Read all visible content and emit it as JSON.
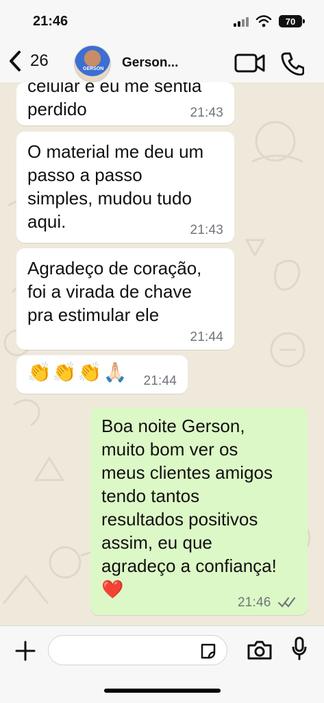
{
  "status": {
    "time": "21:46",
    "battery": "70"
  },
  "header": {
    "back_count": "26",
    "contact_name": "Gerson...",
    "avatar_text": "GERSON"
  },
  "messages": [
    {
      "type": "in",
      "text": "celular e eu me sentia\nperdido",
      "time": "21:43"
    },
    {
      "type": "in",
      "text": "O material me deu um\npasso a passo\nsimples,  mudou tudo\naqui.",
      "time": "21:43"
    },
    {
      "type": "in",
      "text": "Agradeço de coração,\nfoi a virada de chave\npra estimular ele",
      "time": "21:44"
    },
    {
      "type": "in",
      "text": "👏👏👏🙏🏻",
      "time": "21:44"
    },
    {
      "type": "out",
      "text": "Boa noite Gerson,\nmuito bom ver os\nmeus clientes amigos\ntendo tantos\nresultados positivos\nassim, eu que\nagradeço a confiança!\n❤️",
      "time": "21:46"
    }
  ]
}
